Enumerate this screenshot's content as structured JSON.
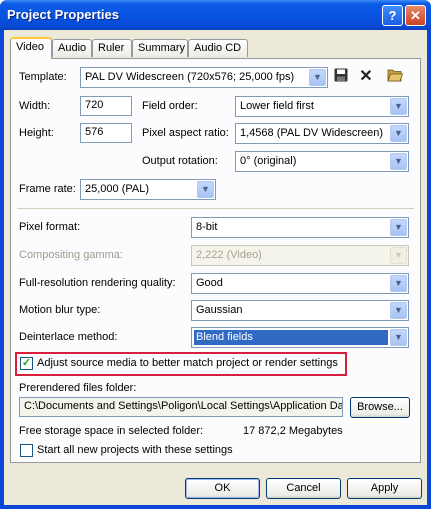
{
  "window": {
    "title": "Project Properties",
    "help_label": "?",
    "close_label": "✕"
  },
  "tabs": [
    {
      "label": "Video",
      "active": true
    },
    {
      "label": "Audio",
      "active": false
    },
    {
      "label": "Ruler",
      "active": false
    },
    {
      "label": "Summary",
      "active": false
    },
    {
      "label": "Audio CD",
      "active": false
    }
  ],
  "video": {
    "template_label": "Template:",
    "template_value": "PAL DV Widescreen (720x576; 25,000 fps)",
    "width_label": "Width:",
    "width_value": "720",
    "height_label": "Height:",
    "height_value": "576",
    "field_order_label": "Field order:",
    "field_order_value": "Lower field first",
    "pixel_aspect_label": "Pixel aspect ratio:",
    "pixel_aspect_value": "1,4568 (PAL DV Widescreen)",
    "output_rotation_label": "Output rotation:",
    "output_rotation_value": "0° (original)",
    "frame_rate_label": "Frame rate:",
    "frame_rate_value": "25,000 (PAL)",
    "pixel_format_label": "Pixel format:",
    "pixel_format_value": "8-bit",
    "compositing_gamma_label": "Compositing gamma:",
    "compositing_gamma_value": "2,222 (Video)",
    "rendering_quality_label": "Full-resolution rendering quality:",
    "rendering_quality_value": "Good",
    "motion_blur_label": "Motion blur type:",
    "motion_blur_value": "Gaussian",
    "deinterlace_label": "Deinterlace method:",
    "deinterlace_value": "Blend fields",
    "adjust_source_label": "Adjust source media to better match project or render settings",
    "adjust_source_checked": true,
    "prerendered_label": "Prerendered files folder:",
    "prerendered_value": "C:\\Documents and Settings\\Poligon\\Local Settings\\Application Da",
    "browse_label": "Browse...",
    "free_space_label": "Free storage space in selected folder:",
    "free_space_value": "17 872,2 Megabytes",
    "start_all_label": "Start all new projects with these settings",
    "start_all_checked": false
  },
  "icons": {
    "save": "floppy-disk-icon",
    "delete": "delete-x-icon",
    "folder": "open-folder-icon"
  },
  "buttons": {
    "ok": "OK",
    "cancel": "Cancel",
    "apply": "Apply"
  },
  "colors": {
    "title_bar": "#0854e3",
    "highlight_box": "#d81e3c",
    "selection": "#316ac5"
  }
}
